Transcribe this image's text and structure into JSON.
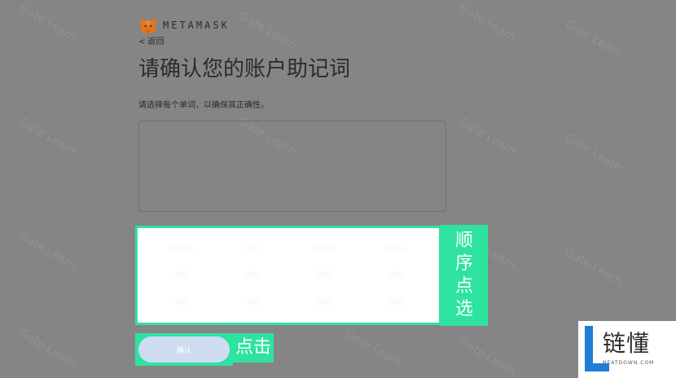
{
  "header": {
    "brand": "METAMASK",
    "back_label": "< 返回"
  },
  "page": {
    "title": "请确认您的账户助记词",
    "description": "请选择每个单词，以确保其正确性。"
  },
  "mnemonic_words": [
    "········",
    "·····",
    "········",
    "······",
    "·····",
    "·····",
    "·······",
    "·····",
    "·····",
    "·····",
    "······",
    "······"
  ],
  "buttons": {
    "confirm_label": "确认"
  },
  "annotations": {
    "order_select": [
      "顺",
      "序",
      "点",
      "选"
    ],
    "click_label": "点击"
  },
  "watermark": {
    "text": "Gate Learn"
  },
  "badge": {
    "title": "链懂",
    "subtitle": "NEATDOWN.COM"
  },
  "colors": {
    "highlight": "#2ee39f",
    "confirm_disabled": "#cfdcf0",
    "overlay": "#858585",
    "badge_blue": "#1f7dd6"
  }
}
